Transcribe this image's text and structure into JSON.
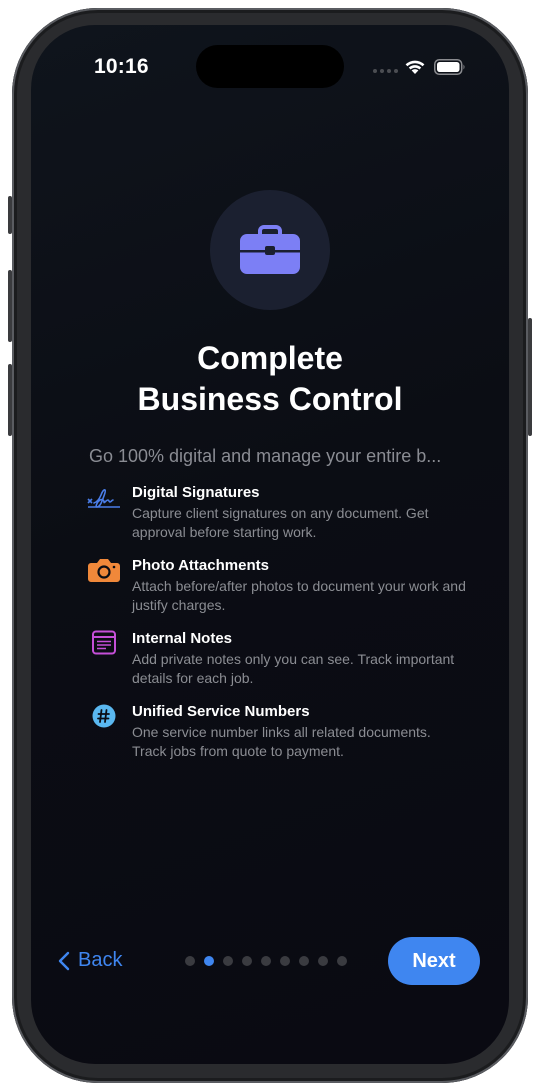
{
  "status_bar": {
    "time": "10:16"
  },
  "hero": {
    "icon": "briefcase-icon",
    "accent": "#7c7ff5"
  },
  "title": {
    "line1": "Complete",
    "line2": "Business Control"
  },
  "subtitle": "Go 100% digital and manage your entire b...",
  "features": [
    {
      "icon": "signature-icon",
      "color": "#4a7de8",
      "title": "Digital Signatures",
      "description": "Capture client signatures on any document. Get approval before starting work."
    },
    {
      "icon": "camera-icon",
      "color": "#f0883a",
      "title": "Photo Attachments",
      "description": "Attach before/after photos to document your work and justify charges."
    },
    {
      "icon": "notes-icon",
      "color": "#c54fd8",
      "title": "Internal Notes",
      "description": "Add private notes only you can see. Track important details for each job."
    },
    {
      "icon": "number-icon",
      "color": "#5ab8f0",
      "title": "Unified Service Numbers",
      "description": "One service number links all related documents. Track jobs from quote to payment."
    }
  ],
  "navigation": {
    "back_label": "Back",
    "next_label": "Next",
    "page_count": 9,
    "current_page": 2
  },
  "colors": {
    "accent": "#3f86f0",
    "background": "#0b0d14"
  }
}
